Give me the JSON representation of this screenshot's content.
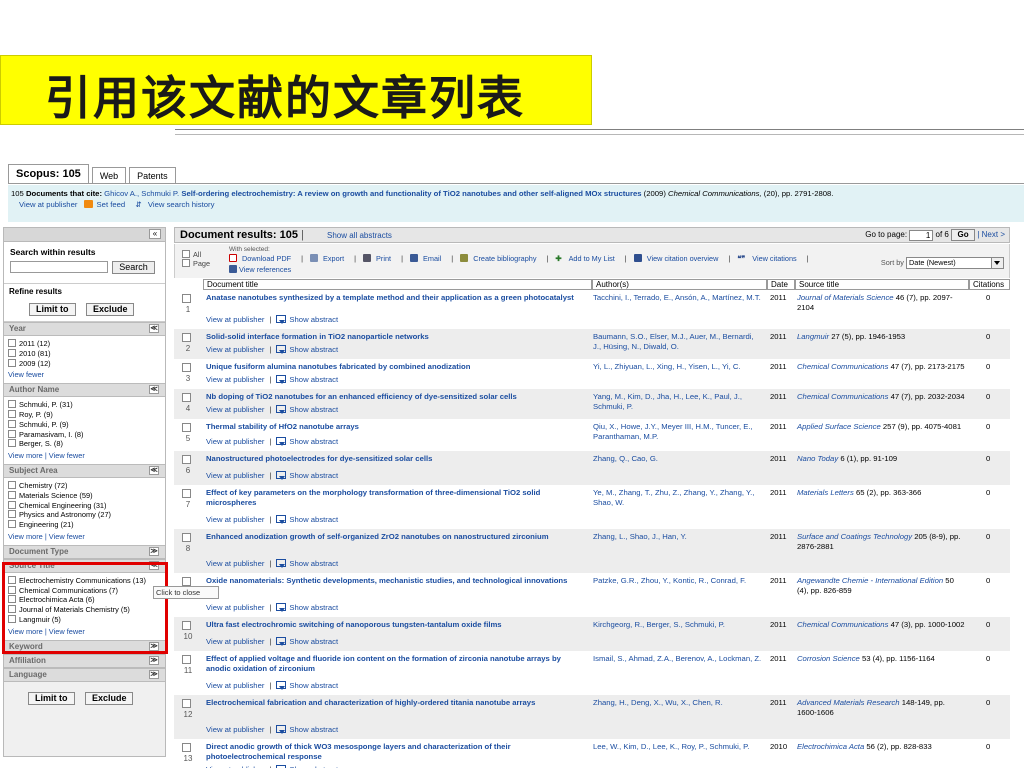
{
  "slide": {
    "title": "引用该文献的文章列表"
  },
  "tabs": [
    "Scopus: 105",
    "Web",
    "Patents"
  ],
  "citing": {
    "count": "105",
    "label": "Documents that cite:",
    "authors": "Ghicov A., Schmuki P.",
    "title": "Self-ordering electrochemistry: A review on growth and functionality of TiO2 nanotubes and other self-aligned MOx structures",
    "year": "(2009)",
    "journal": "Chemical Communications,",
    "details": "(20), pp. 2791-2808.",
    "links": [
      "View at publisher",
      "Set feed",
      "View search history"
    ]
  },
  "sidebar": {
    "collapse": "«",
    "search_label": "Search within results",
    "search_button": "Search",
    "refine_label": "Refine results",
    "limit_button": "Limit to",
    "exclude_button": "Exclude",
    "facets": [
      {
        "name": "Year",
        "toggle": "≪",
        "items": [
          "2011 (12)",
          "2010 (81)",
          "2009 (12)"
        ],
        "more": "View fewer"
      },
      {
        "name": "Author Name",
        "toggle": "≪",
        "items": [
          "Schmuki, P. (31)",
          "Roy, P. (9)",
          "Schmuki, P. (9)",
          "Paramasivam, I. (8)",
          "Berger, S. (8)"
        ],
        "more": "View more | View fewer"
      },
      {
        "name": "Subject Area",
        "toggle": "≪",
        "items": [
          "Chemistry (72)",
          "Materials Science (59)",
          "Chemical Engineering (31)",
          "Physics and Astronomy (27)",
          "Engineering (21)"
        ],
        "more": "View more | View fewer"
      },
      {
        "name": "Document Type",
        "toggle": "≫",
        "items": [],
        "more": ""
      },
      {
        "name": "Source Title",
        "toggle": "≪",
        "items": [
          "Electrochemistry Communications (13)",
          "Chemical Communications (7)",
          "Electrochimica Acta (6)",
          "Journal of Materials Chemistry (5)",
          "Langmuir (5)"
        ],
        "more": "View more | View fewer"
      },
      {
        "name": "Keyword",
        "toggle": "≫",
        "items": [],
        "more": ""
      },
      {
        "name": "Affiliation",
        "toggle": "≫",
        "items": [],
        "more": ""
      },
      {
        "name": "Language",
        "toggle": "≫",
        "items": [],
        "more": ""
      }
    ],
    "bottom_limit": "Limit to",
    "bottom_exclude": "Exclude",
    "tooltip": "Click to close"
  },
  "results": {
    "heading": "Document results: 105",
    "show_all": "Show all abstracts",
    "goto_label": "Go to page:",
    "page": "1",
    "of_pages": "of 6",
    "go": "Go",
    "next": "| Next >",
    "select_all": "All",
    "select_page": "Page",
    "with_selected": "With selected:",
    "actions": [
      "Download PDF",
      "Export",
      "Print",
      "Email",
      "Create bibliography",
      "Add to My List",
      "View citation overview",
      "View citations"
    ],
    "view_refs": "View references",
    "sort_label": "Sort by",
    "sort_value": "Date (Newest)",
    "columns": [
      "Document title",
      "Author(s)",
      "Date",
      "Source title",
      "Citations"
    ],
    "view_publisher": "View at publisher",
    "show_abstract": "Show abstract",
    "rows": [
      {
        "n": "1",
        "title": "Anatase nanotubes synthesized by a template method and their application as a green photocatalyst",
        "authors": "Tacchini, I., Terrado, E., Ansón, A., Martínez, M.T.",
        "year": "2011",
        "source": "Journal of Materials Science",
        "src_detail": "46 (7), pp. 2097-2104",
        "cites": "0"
      },
      {
        "n": "2",
        "title": "Solid-solid interface formation in TiO2 nanoparticle networks",
        "authors": "Baumann, S.O., Elser, M.J., Auer, M., Bernardi, J., Hüsing, N., Diwald, O.",
        "year": "2011",
        "source": "Langmuir",
        "src_detail": "27 (5), pp. 1946-1953",
        "cites": "0"
      },
      {
        "n": "3",
        "title": "Unique fusiform alumina nanotubes fabricated by combined anodization",
        "authors": "Yi, L., Zhiyuan, L., Xing, H., Yisen, L., Yi, C.",
        "year": "2011",
        "source": "Chemical Communications",
        "src_detail": "47 (7), pp. 2173-2175",
        "cites": "0"
      },
      {
        "n": "4",
        "title": "Nb doping of TiO2 nanotubes for an enhanced efficiency of dye-sensitized solar cells",
        "authors": "Yang, M., Kim, D., Jha, H., Lee, K., Paul, J., Schmuki, P.",
        "year": "2011",
        "source": "Chemical Communications",
        "src_detail": "47 (7), pp. 2032-2034",
        "cites": "0"
      },
      {
        "n": "5",
        "title": "Thermal stability of HfO2 nanotube arrays",
        "authors": "Qiu, X., Howe, J.Y., Meyer III, H.M., Tuncer, E., Paranthaman, M.P.",
        "year": "2011",
        "source": "Applied Surface Science",
        "src_detail": "257 (9), pp. 4075-4081",
        "cites": "0"
      },
      {
        "n": "6",
        "title": "Nanostructured photoelectrodes for dye-sensitized solar cells",
        "authors": "Zhang, Q., Cao, G.",
        "year": "2011",
        "source": "Nano Today",
        "src_detail": "6 (1), pp. 91-109",
        "cites": "0"
      },
      {
        "n": "7",
        "title": "Effect of key parameters on the morphology transformation of three-dimensional TiO2 solid microspheres",
        "authors": "Ye, M., Zhang, T., Zhu, Z., Zhang, Y., Zhang, Y., Shao, W.",
        "year": "2011",
        "source": "Materials Letters",
        "src_detail": "65 (2), pp. 363-366",
        "cites": "0"
      },
      {
        "n": "8",
        "title": "Enhanced anodization growth of self-organized ZrO2 nanotubes on nanostructured zirconium",
        "authors": "Zhang, L., Shao, J., Han, Y.",
        "year": "2011",
        "source": "Surface and Coatings Technology",
        "src_detail": "205 (8-9), pp. 2876-2881",
        "cites": "0"
      },
      {
        "n": "9",
        "title": "Oxide nanomaterials: Synthetic developments, mechanistic studies, and technological innovations",
        "authors": "Patzke, G.R., Zhou, Y., Kontic, R., Conrad, F.",
        "year": "2011",
        "source": "Angewandte Chemie - International Edition",
        "src_detail": "50 (4), pp. 826-859",
        "cites": "0"
      },
      {
        "n": "10",
        "title": "Ultra fast electrochromic switching of nanoporous tungsten-tantalum oxide films",
        "authors": "Kirchgeorg, R., Berger, S., Schmuki, P.",
        "year": "2011",
        "source": "Chemical Communications",
        "src_detail": "47 (3), pp. 1000-1002",
        "cites": "0"
      },
      {
        "n": "11",
        "title": "Effect of applied voltage and fluoride ion content on the formation of zirconia nanotube arrays by anodic oxidation of zirconium",
        "authors": "Ismail, S., Ahmad, Z.A., Berenov, A., Lockman, Z.",
        "year": "2011",
        "source": "Corrosion Science",
        "src_detail": "53 (4), pp. 1156-1164",
        "cites": "0"
      },
      {
        "n": "12",
        "title": "Electrochemical fabrication and characterization of highly-ordered titania nanotube arrays",
        "authors": "Zhang, H., Deng, X., Wu, X., Chen, R.",
        "year": "2011",
        "source": "Advanced Materials Research",
        "src_detail": "148-149, pp. 1600-1606",
        "cites": "0"
      },
      {
        "n": "13",
        "title": "Direct anodic growth of thick WO3 mesosponge layers and characterization of their photoelectrochemical response",
        "authors": "Lee, W., Kim, D., Lee, K., Roy, P., Schmuki, P.",
        "year": "2010",
        "source": "Electrochimica Acta",
        "src_detail": "56 (2), pp. 828-833",
        "cites": "0"
      }
    ]
  },
  "colors": {
    "link": "#1b4da0",
    "banner": "#ffff00",
    "highlight": "#e00000",
    "cite_bg": "#e1f2f5"
  }
}
